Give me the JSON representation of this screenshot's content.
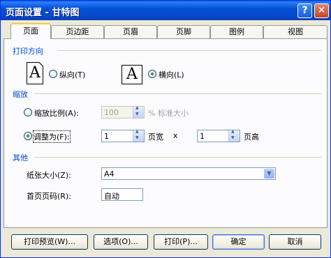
{
  "window": {
    "title": "页面设置 - 甘特图"
  },
  "titlebar_buttons": {
    "help": "?",
    "close": "✕"
  },
  "tabs": [
    {
      "label": "页面",
      "active": true
    },
    {
      "label": "页边距"
    },
    {
      "label": "页眉"
    },
    {
      "label": "页脚"
    },
    {
      "label": "图例"
    },
    {
      "label": "视图"
    }
  ],
  "orientation": {
    "section": "打印方向",
    "portrait_label": "纵向(T)",
    "landscape_label": "横向(L)",
    "selected": "landscape",
    "icon_glyph": "A"
  },
  "scaling": {
    "section": "缩放",
    "adjust_to_label": "缩放比例(A):",
    "adjust_to_value": "100",
    "adjust_to_suffix": "% 标准大小",
    "fit_to_label": "调整为(F):",
    "pages_wide_value": "1",
    "pages_wide_label": "页宽",
    "by_label": "x",
    "pages_tall_value": "1",
    "pages_tall_label": "页高",
    "selected": "fit_to"
  },
  "other": {
    "section": "其他",
    "paper_size_label": "纸张大小(Z):",
    "paper_size_value": "A4",
    "first_page_label": "首页页码(R):",
    "first_page_value": "自动"
  },
  "buttons": {
    "print_preview": "打印预览(W)...",
    "options": "选项(O)...",
    "print": "打印(P)...",
    "ok": "确定",
    "cancel": "取消"
  }
}
